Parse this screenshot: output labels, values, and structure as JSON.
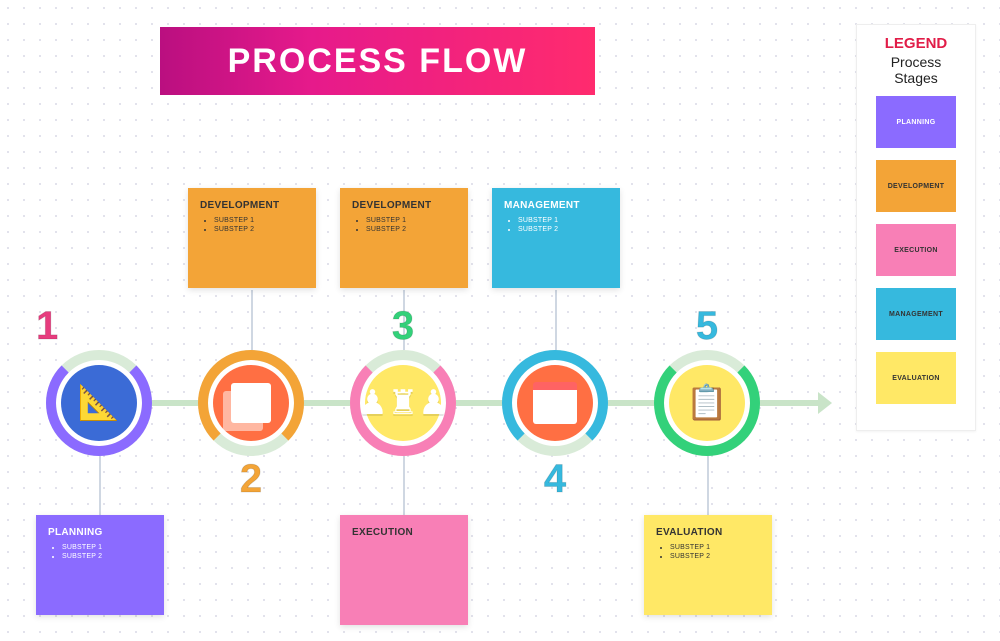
{
  "title": "PROCESS FLOW",
  "legend": {
    "title": "LEGEND",
    "subtitle": "Process Stages",
    "items": [
      {
        "label": "PLANNING",
        "color": "#8b6bff"
      },
      {
        "label": "DEVELOPMENT",
        "color": "#f3a437"
      },
      {
        "label": "EXECUTION",
        "color": "#f87fb6"
      },
      {
        "label": "MANAGEMENT",
        "color": "#36b9de"
      },
      {
        "label": "EVALUATION",
        "color": "#ffe866"
      }
    ]
  },
  "nodes": {
    "n1": {
      "number": "1",
      "color_num": "#f06292",
      "icon": "plan-icon"
    },
    "n2": {
      "number": "2",
      "color_num": "#f3a437",
      "icon": "docs-icon"
    },
    "n2b": {
      "number": "",
      "color_num": "",
      "icon": "docs-icon"
    },
    "n3": {
      "number": "3",
      "color_num": "#33d17a",
      "icon": "chess-icon"
    },
    "n4": {
      "number": "4",
      "color_num": "#36b9de",
      "icon": "browser-icon"
    },
    "n5": {
      "number": "5",
      "color_num": "#36b9de",
      "icon": "clipboard-icon"
    }
  },
  "cards": {
    "planning": {
      "title": "PLANNING",
      "bullets": [
        "SUBSTEP 1",
        "SUBSTEP 2"
      ]
    },
    "development1": {
      "title": "DEVELOPMENT",
      "bullets": [
        "SUBSTEP 1",
        "SUBSTEP 2"
      ]
    },
    "development2": {
      "title": "DEVELOPMENT",
      "bullets": [
        "SUBSTEP 1",
        "SUBSTEP 2"
      ]
    },
    "execution": {
      "title": "EXECUTION",
      "bullets": []
    },
    "management": {
      "title": "MANAGEMENT",
      "bullets": [
        "SUBSTEP 1",
        "SUBSTEP 2"
      ]
    },
    "evaluation": {
      "title": "EVALUATION",
      "bullets": [
        "SUBSTEP 1",
        "SUBSTEP 2"
      ]
    }
  }
}
